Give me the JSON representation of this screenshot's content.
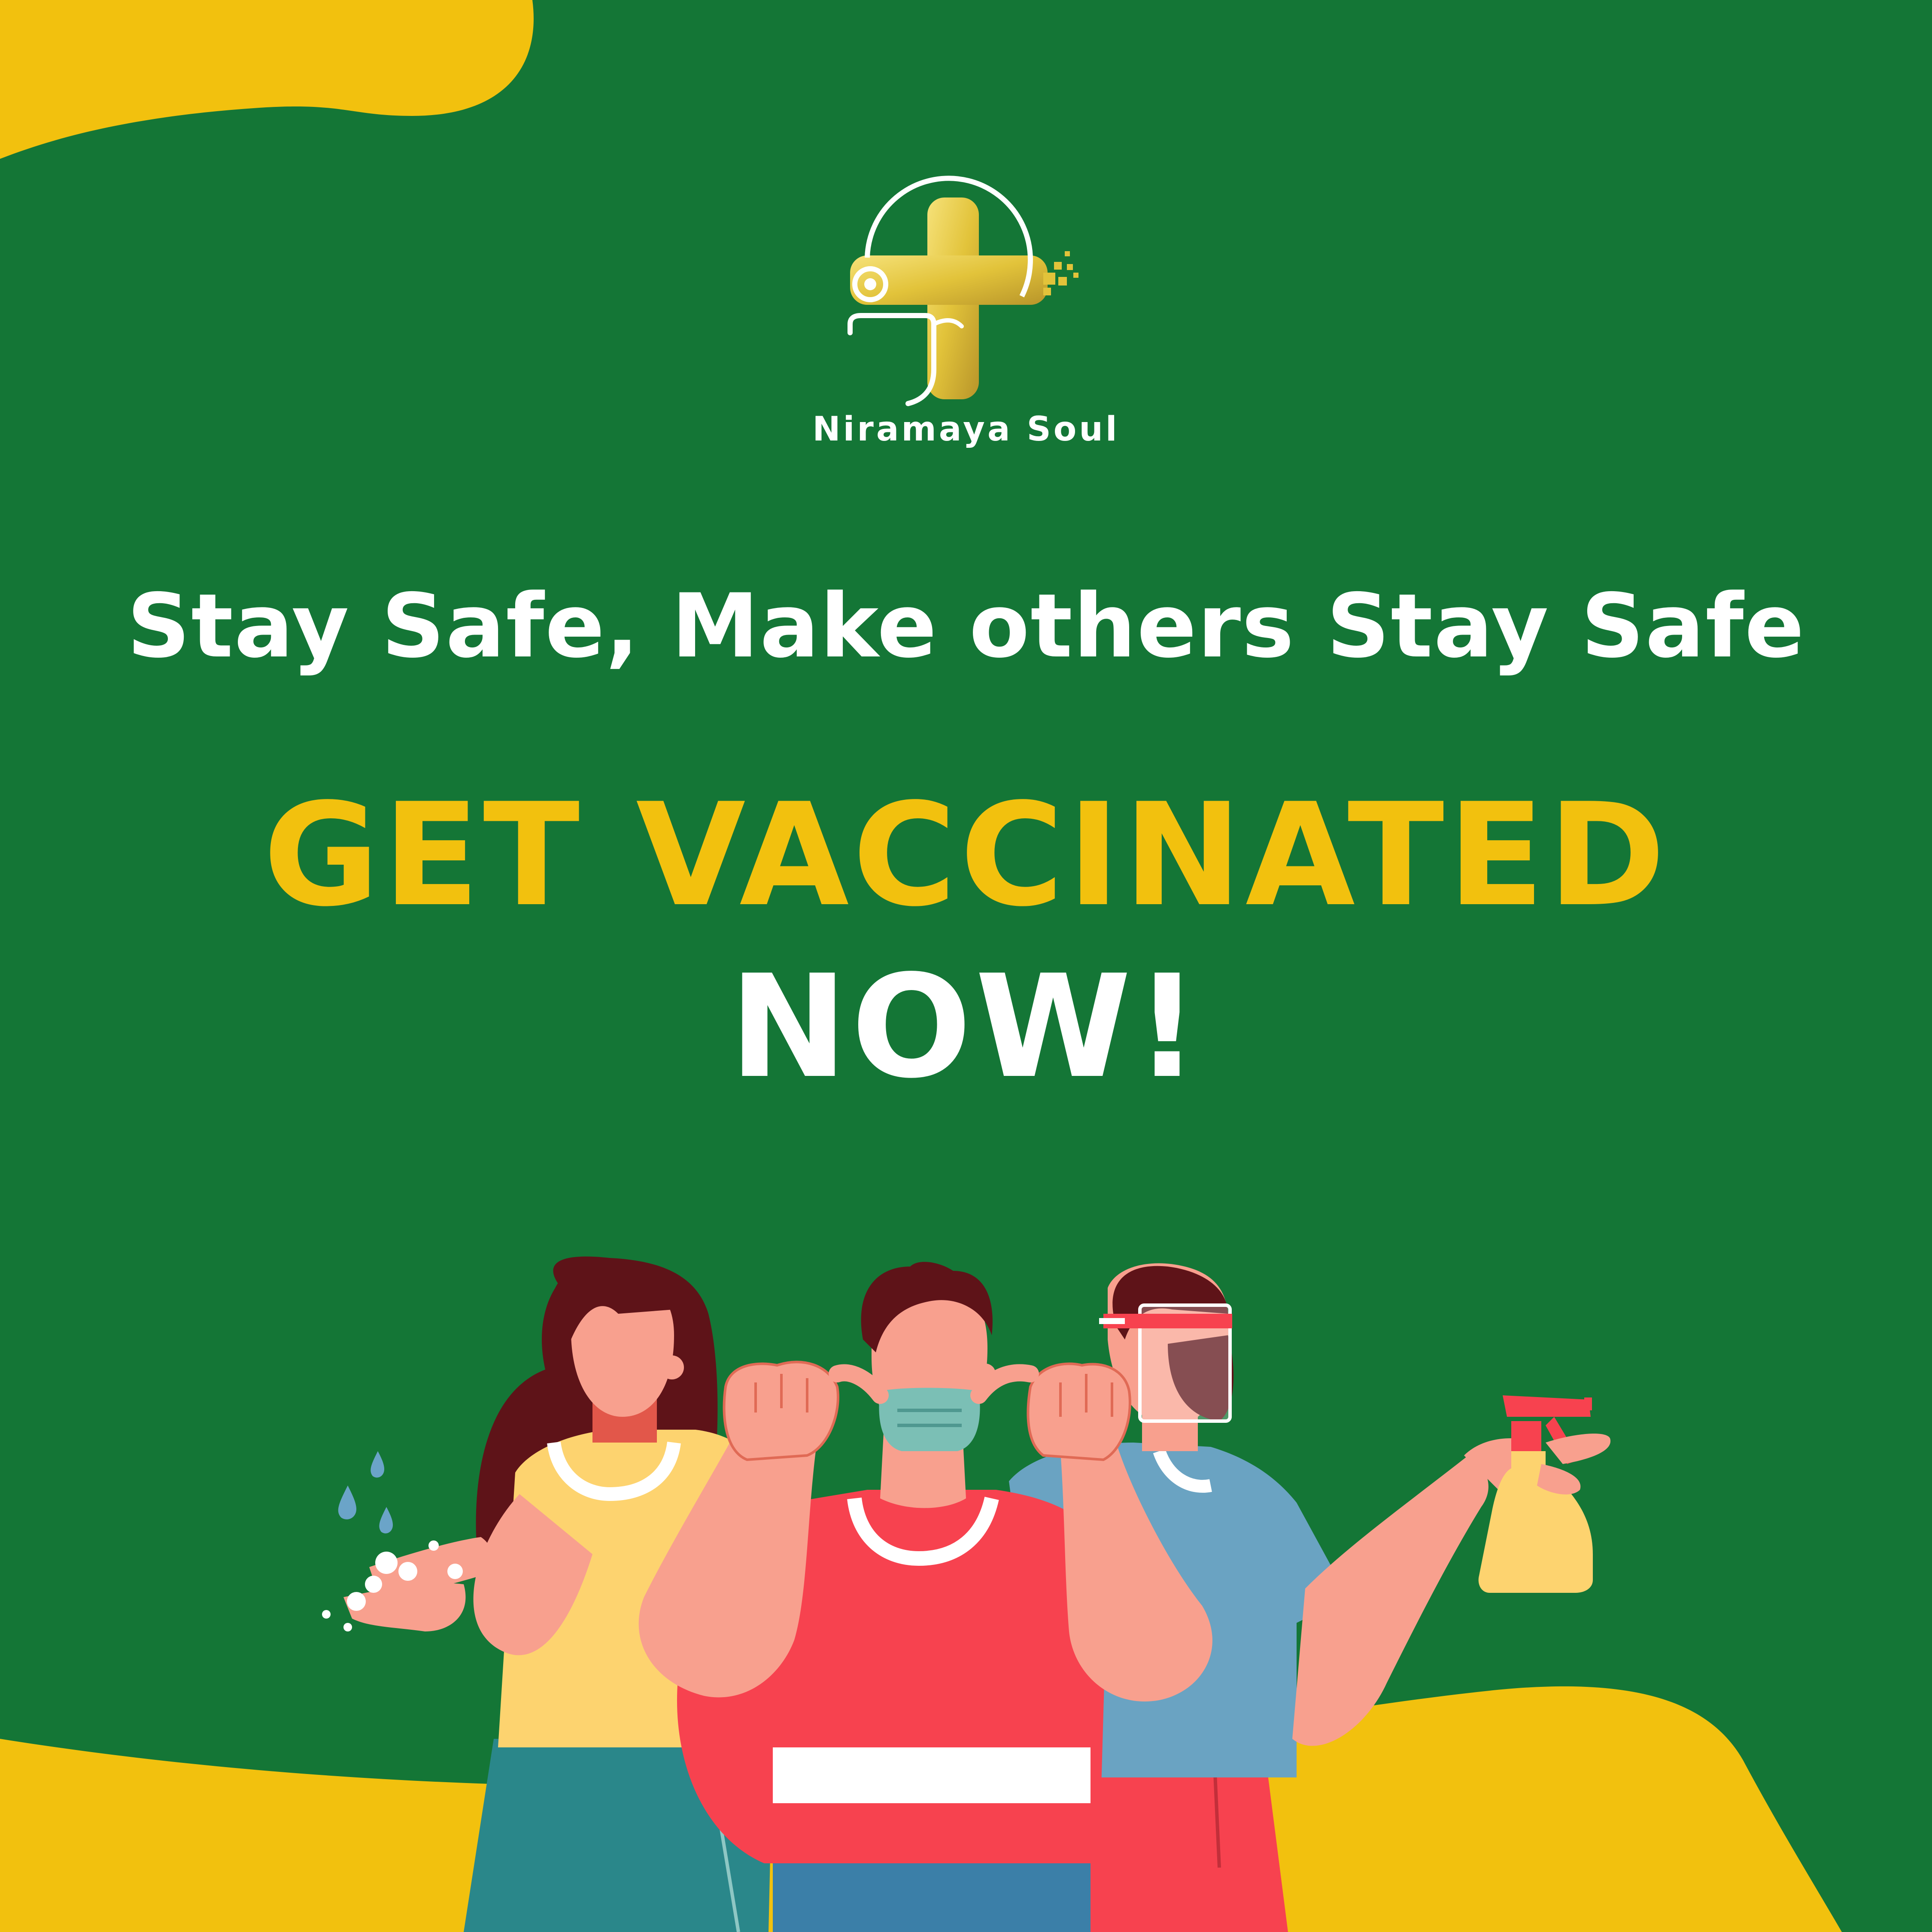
{
  "brand": {
    "name": "Niramaya Soul",
    "logo_icon": "medical-cross-stethoscope-icon"
  },
  "tagline": "Stay Safe, Make others Stay Safe",
  "headline": {
    "line1": "GET VACCINATED",
    "line2": "NOW!"
  },
  "colors": {
    "background": "#147636",
    "accent": "#f2c10e",
    "text": "#ffffff"
  },
  "illustration": {
    "icon": "people-practicing-safety-illustration"
  }
}
